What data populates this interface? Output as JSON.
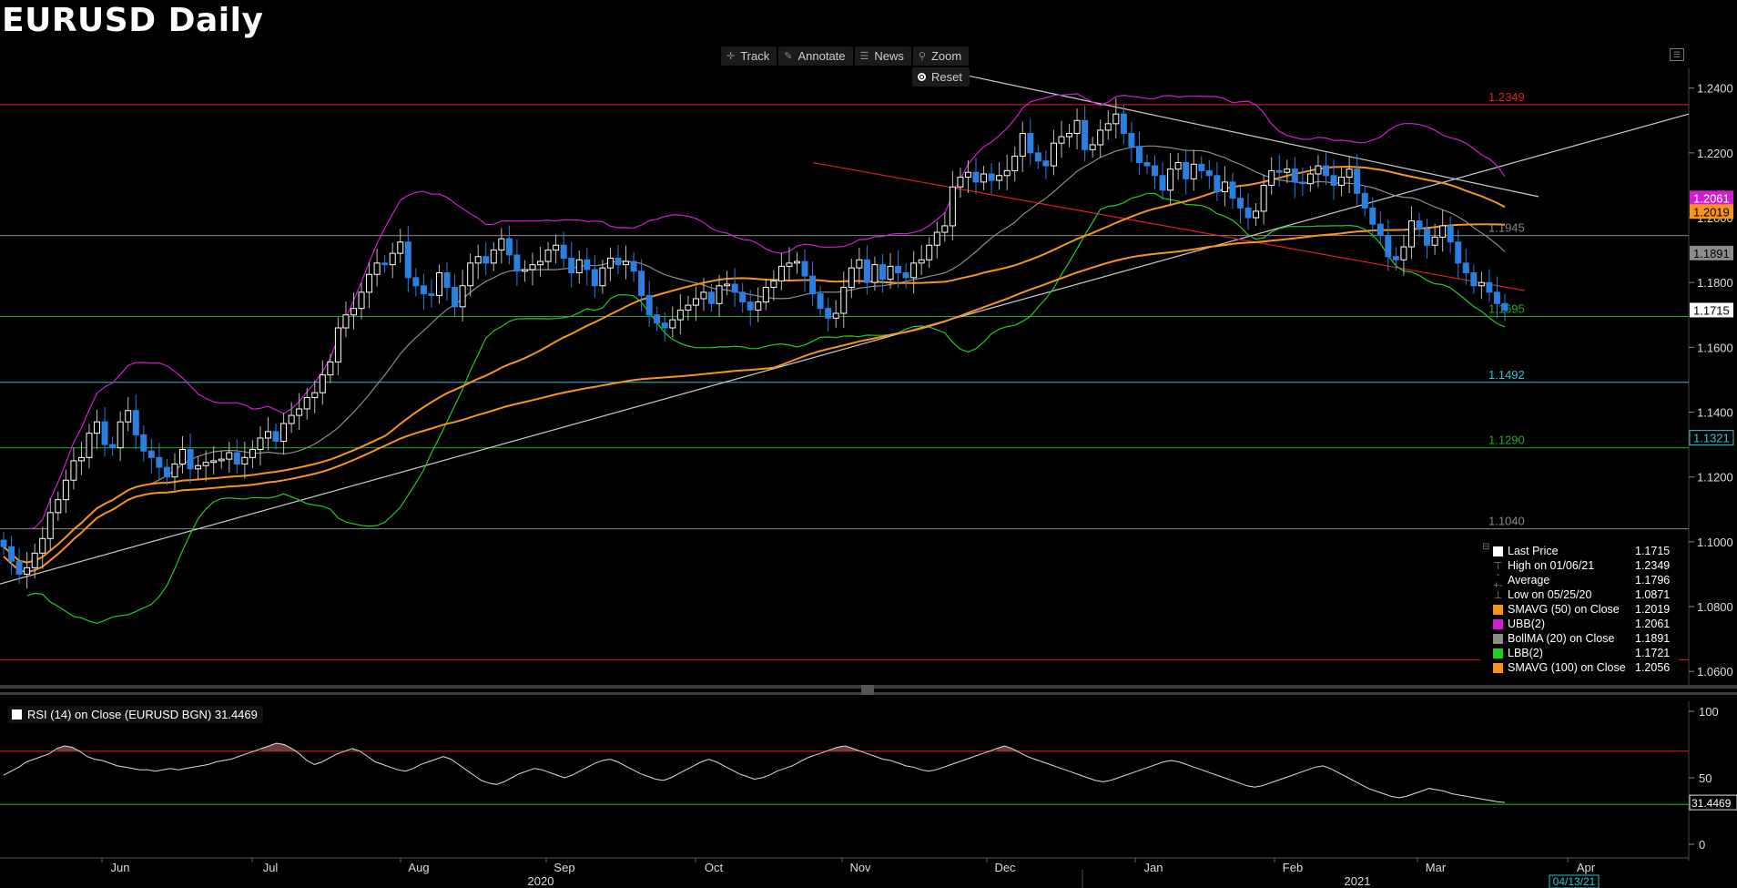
{
  "title": "EURUSD Daily",
  "toolbar": {
    "track": "Track",
    "annotate": "Annotate",
    "news": "News",
    "zoom": "Zoom",
    "reset": "Reset"
  },
  "colors": {
    "bull": "#ffffff",
    "bear": "#2b7fe0",
    "smavg50": "#f7941d",
    "smavg100": "#f7941d",
    "ubb": "#d21ed2",
    "lbb": "#22cc22",
    "bollma": "#8c8c8c",
    "trend": "#cccccc",
    "red": "#e02020",
    "cyan": "#2ec4d0",
    "green": "#22aa22"
  },
  "chart_data": [
    {
      "type": "candlestick",
      "title": "EURUSD Daily",
      "ylim": [
        1.055,
        1.2475
      ],
      "y_ticks": [
        "1.2400",
        "1.2200",
        "1.2000",
        "1.1800",
        "1.1600",
        "1.1400",
        "1.1200",
        "1.1000",
        "1.0800",
        "1.0600"
      ],
      "x_month_labels": [
        "Jun",
        "Jul",
        "Aug",
        "Sep",
        "Oct",
        "Nov",
        "Dec",
        "Jan",
        "Feb",
        "Mar",
        "Apr"
      ],
      "x_year_labels": [
        "2020",
        "2021"
      ],
      "date_marker": "04/13/21",
      "close": [
        1.0985,
        1.094,
        1.09,
        1.092,
        1.0965,
        1.101,
        1.109,
        1.113,
        1.119,
        1.125,
        1.126,
        1.1335,
        1.137,
        1.13,
        1.129,
        1.137,
        1.1405,
        1.133,
        1.128,
        1.126,
        1.123,
        1.12,
        1.124,
        1.1285,
        1.1225,
        1.1235,
        1.1245,
        1.125,
        1.1255,
        1.1275,
        1.124,
        1.126,
        1.1285,
        1.132,
        1.134,
        1.131,
        1.1365,
        1.139,
        1.141,
        1.1445,
        1.146,
        1.1515,
        1.1555,
        1.166,
        1.17,
        1.172,
        1.177,
        1.1825,
        1.186,
        1.1855,
        1.189,
        1.1925,
        1.1815,
        1.179,
        1.1765,
        1.176,
        1.183,
        1.1785,
        1.1725,
        1.179,
        1.186,
        1.188,
        1.186,
        1.19,
        1.1935,
        1.1885,
        1.1835,
        1.184,
        1.1855,
        1.1865,
        1.19,
        1.1915,
        1.1875,
        1.183,
        1.187,
        1.184,
        1.179,
        1.1845,
        1.1875,
        1.1855,
        1.1865,
        1.1835,
        1.176,
        1.17,
        1.1675,
        1.166,
        1.1685,
        1.1715,
        1.173,
        1.175,
        1.177,
        1.1735,
        1.179,
        1.1795,
        1.177,
        1.174,
        1.1715,
        1.174,
        1.1785,
        1.1805,
        1.185,
        1.186,
        1.1865,
        1.182,
        1.1765,
        1.172,
        1.169,
        1.1705,
        1.1785,
        1.1845,
        1.187,
        1.18,
        1.1855,
        1.181,
        1.185,
        1.183,
        1.1815,
        1.186,
        1.187,
        1.1915,
        1.1955,
        1.1975,
        1.2095,
        1.2125,
        1.214,
        1.211,
        1.2135,
        1.2115,
        1.213,
        1.2145,
        1.219,
        1.226,
        1.22,
        1.2175,
        1.216,
        1.223,
        1.225,
        1.226,
        1.23,
        1.221,
        1.2225,
        1.227,
        1.229,
        1.232,
        1.226,
        1.222,
        1.217,
        1.216,
        1.213,
        1.2085,
        1.215,
        1.217,
        1.212,
        1.2165,
        1.2145,
        1.213,
        1.208,
        1.211,
        1.206,
        1.203,
        1.2,
        1.202,
        1.21,
        1.2145,
        1.214,
        1.215,
        1.211,
        1.2105,
        1.2135,
        1.216,
        1.213,
        1.21,
        1.2125,
        1.215,
        1.2075,
        1.203,
        1.198,
        1.1945,
        1.188,
        1.187,
        1.191,
        1.199,
        1.1965,
        1.1915,
        1.194,
        1.1975,
        1.1925,
        1.186,
        1.183,
        1.179,
        1.18,
        1.177,
        1.1735,
        1.1715
      ],
      "series": [
        {
          "name": "SMAVG (50)  on Close",
          "last": "1.2019"
        },
        {
          "name": "UBB(2)",
          "last": "1.2061"
        },
        {
          "name": "BollMA (20)  on Close",
          "last": "1.1891"
        },
        {
          "name": "LBB(2)",
          "last": "1.1721"
        },
        {
          "name": "SMAVG (100)  on Close",
          "last": "1.2056"
        }
      ],
      "horizontal_levels": [
        {
          "value": 1.2349,
          "label": "1.2349",
          "color": "#e02020"
        },
        {
          "value": 1.1945,
          "label": "1.1945",
          "color": "#888888"
        },
        {
          "value": 1.1695,
          "label": "1.1695",
          "color": "#22aa22"
        },
        {
          "value": 1.1492,
          "label": "1.1492",
          "color": "#2ec4d0"
        },
        {
          "value": 1.129,
          "label": "1.1290",
          "color": "#22aa22"
        },
        {
          "value": 1.104,
          "label": "1.1040",
          "color": "#888888"
        },
        {
          "value": 1.0636,
          "label": "",
          "color": "#e02020"
        }
      ],
      "price_tags": [
        {
          "value": 1.2061,
          "label": "1.2061",
          "bg": "#d21ed2",
          "fg": "#ffffff"
        },
        {
          "value": 1.2019,
          "label": "1.2019",
          "bg": "#f7941d",
          "fg": "#000000"
        },
        {
          "value": 1.1891,
          "label": "1.1891",
          "bg": "#8c8c8c",
          "fg": "#000000"
        },
        {
          "value": 1.1715,
          "label": "1.1715",
          "bg": "#ffffff",
          "fg": "#000000"
        },
        {
          "value": 1.1321,
          "label": "1.1321",
          "bg": "#000000",
          "fg": "#2ec4d0"
        }
      ]
    },
    {
      "type": "line",
      "title": "RSI (14)  on Close (EURUSD BGN) 31.4469",
      "ylim": [
        0,
        100
      ],
      "y_ticks": [
        "100",
        "50",
        "0"
      ],
      "overbought": 70,
      "oversold": 30,
      "last": "31.4469",
      "values": [
        52,
        55,
        58,
        62,
        64,
        66,
        68,
        72,
        74,
        73,
        70,
        66,
        64,
        63,
        61,
        59,
        58,
        57,
        56,
        56,
        55,
        56,
        57,
        56,
        57,
        58,
        59,
        60,
        62,
        63,
        64,
        66,
        68,
        70,
        72,
        74,
        76,
        75,
        72,
        68,
        63,
        60,
        62,
        65,
        68,
        70,
        72,
        70,
        66,
        62,
        60,
        58,
        56,
        55,
        57,
        60,
        62,
        64,
        66,
        64,
        60,
        56,
        52,
        48,
        46,
        45,
        47,
        50,
        53,
        55,
        57,
        56,
        54,
        52,
        50,
        52,
        55,
        58,
        61,
        63,
        64,
        62,
        59,
        56,
        53,
        51,
        49,
        48,
        50,
        53,
        56,
        59,
        62,
        64,
        62,
        59,
        56,
        53,
        51,
        49,
        50,
        52,
        55,
        57,
        59,
        62,
        65,
        67,
        69,
        71,
        73,
        74,
        72,
        70,
        68,
        66,
        64,
        63,
        61,
        59,
        58,
        56,
        55,
        56,
        58,
        60,
        62,
        64,
        66,
        68,
        70,
        72,
        74,
        72,
        69,
        66,
        64,
        62,
        60,
        58,
        56,
        54,
        52,
        50,
        48,
        47,
        48,
        50,
        52,
        54,
        56,
        58,
        60,
        62,
        63,
        62,
        60,
        58,
        56,
        54,
        52,
        50,
        48,
        46,
        44,
        43,
        44,
        46,
        48,
        50,
        52,
        54,
        56,
        58,
        59,
        57,
        54,
        51,
        48,
        45,
        42,
        40,
        38,
        36,
        35,
        36,
        38,
        40,
        42,
        41,
        40,
        38,
        37,
        36,
        35,
        34,
        33,
        32,
        31.4469
      ]
    }
  ],
  "legend": {
    "items": [
      {
        "label": "Last Price",
        "value": "1.1715",
        "glyph": "",
        "color": "#ffffff"
      },
      {
        "label": "High on 01/06/21",
        "value": "1.2349",
        "glyph": "⊤",
        "color": ""
      },
      {
        "label": "Average",
        "value": "1.1796",
        "glyph": "-+-",
        "color": ""
      },
      {
        "label": "Low on 05/25/20",
        "value": "1.0871",
        "glyph": "⊥",
        "color": ""
      },
      {
        "label": "SMAVG (50)  on Close",
        "value": "1.2019",
        "glyph": "",
        "color": "#f7941d"
      },
      {
        "label": "UBB(2)",
        "value": "1.2061",
        "glyph": "",
        "color": "#d21ed2"
      },
      {
        "label": "BollMA (20)  on Close",
        "value": "1.1891",
        "glyph": "",
        "color": "#8c8c8c"
      },
      {
        "label": "LBB(2)",
        "value": "1.1721",
        "glyph": "",
        "color": "#22cc22"
      },
      {
        "label": "SMAVG (100)  on Close",
        "value": "1.2056",
        "glyph": "",
        "color": "#f7941d"
      }
    ]
  },
  "rsi_label": "RSI (14)  on Close (EURUSD BGN) 31.4469"
}
